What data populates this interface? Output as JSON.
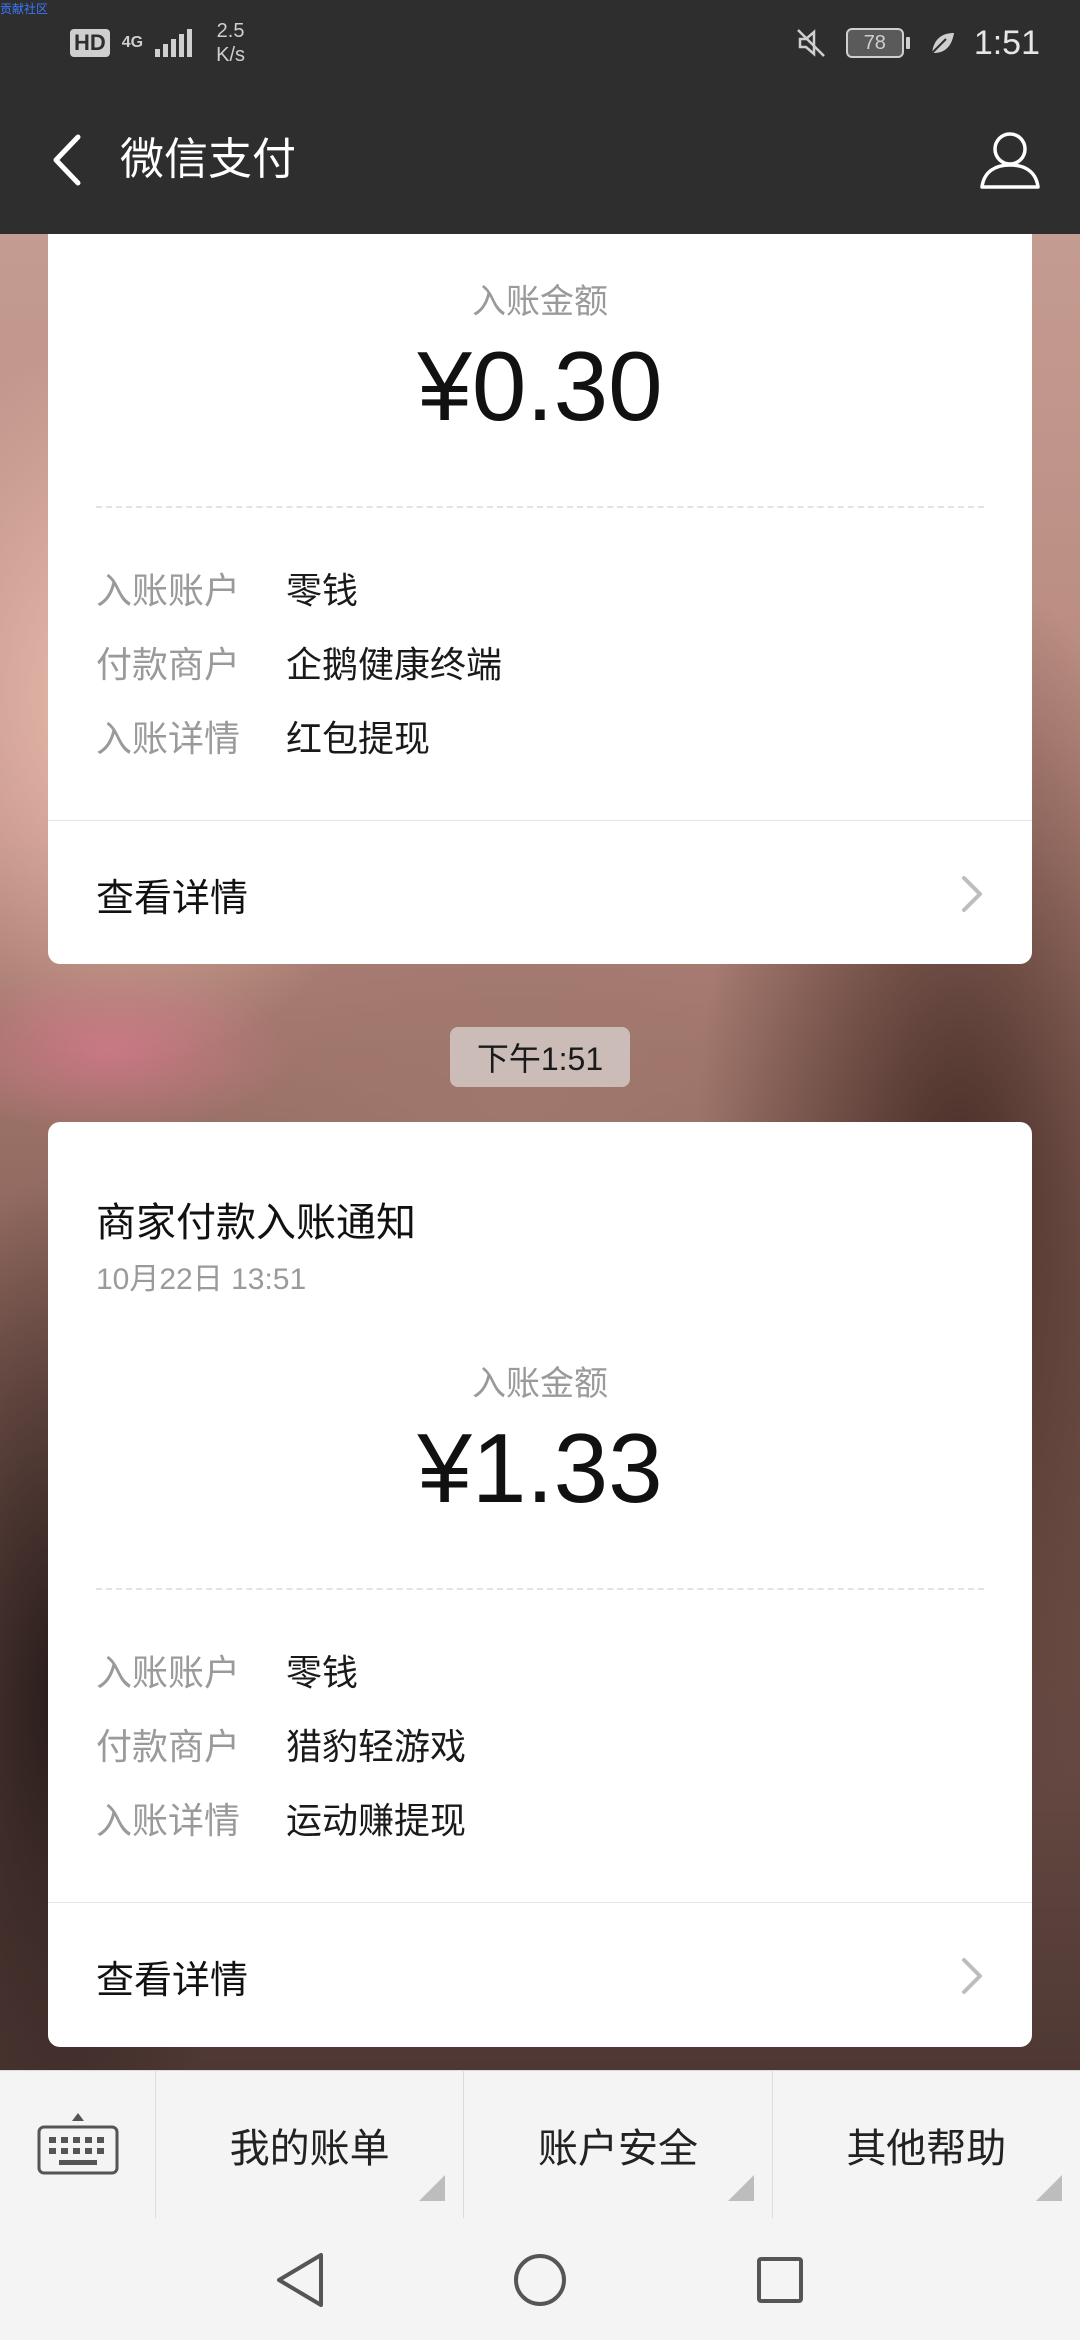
{
  "watermark": "贡献社区",
  "status_bar": {
    "hd": "HD",
    "network": "4G",
    "speed_value": "2.5",
    "speed_unit": "K/s",
    "battery": "78",
    "time": "1:51"
  },
  "app_bar": {
    "title": "微信支付",
    "back_icon": "back-arrow-icon",
    "profile_icon": "person-icon"
  },
  "messages": [
    {
      "amount_label": "入账金额",
      "amount": "¥0.30",
      "details": [
        {
          "key": "入账账户",
          "value": "零钱"
        },
        {
          "key": "付款商户",
          "value": "企鹅健康终端"
        },
        {
          "key": "入账详情",
          "value": "红包提现"
        }
      ],
      "view_details": "查看详情"
    },
    {
      "title": "商家付款入账通知",
      "date": "10月22日  13:51",
      "amount_label": "入账金额",
      "amount": "¥1.33",
      "details": [
        {
          "key": "入账账户",
          "value": "零钱"
        },
        {
          "key": "付款商户",
          "value": "猎豹轻游戏"
        },
        {
          "key": "入账详情",
          "value": "运动赚提现"
        }
      ],
      "view_details": "查看详情"
    }
  ],
  "timestamp_chip": "下午1:51",
  "bottom_menu": {
    "keyboard_icon": "keyboard-icon",
    "items": [
      {
        "label": "我的账单"
      },
      {
        "label": "账户安全"
      },
      {
        "label": "其他帮助"
      }
    ]
  },
  "nav_bar": {
    "back": "triangle-back-icon",
    "home": "circle-home-icon",
    "recents": "square-recents-icon"
  }
}
